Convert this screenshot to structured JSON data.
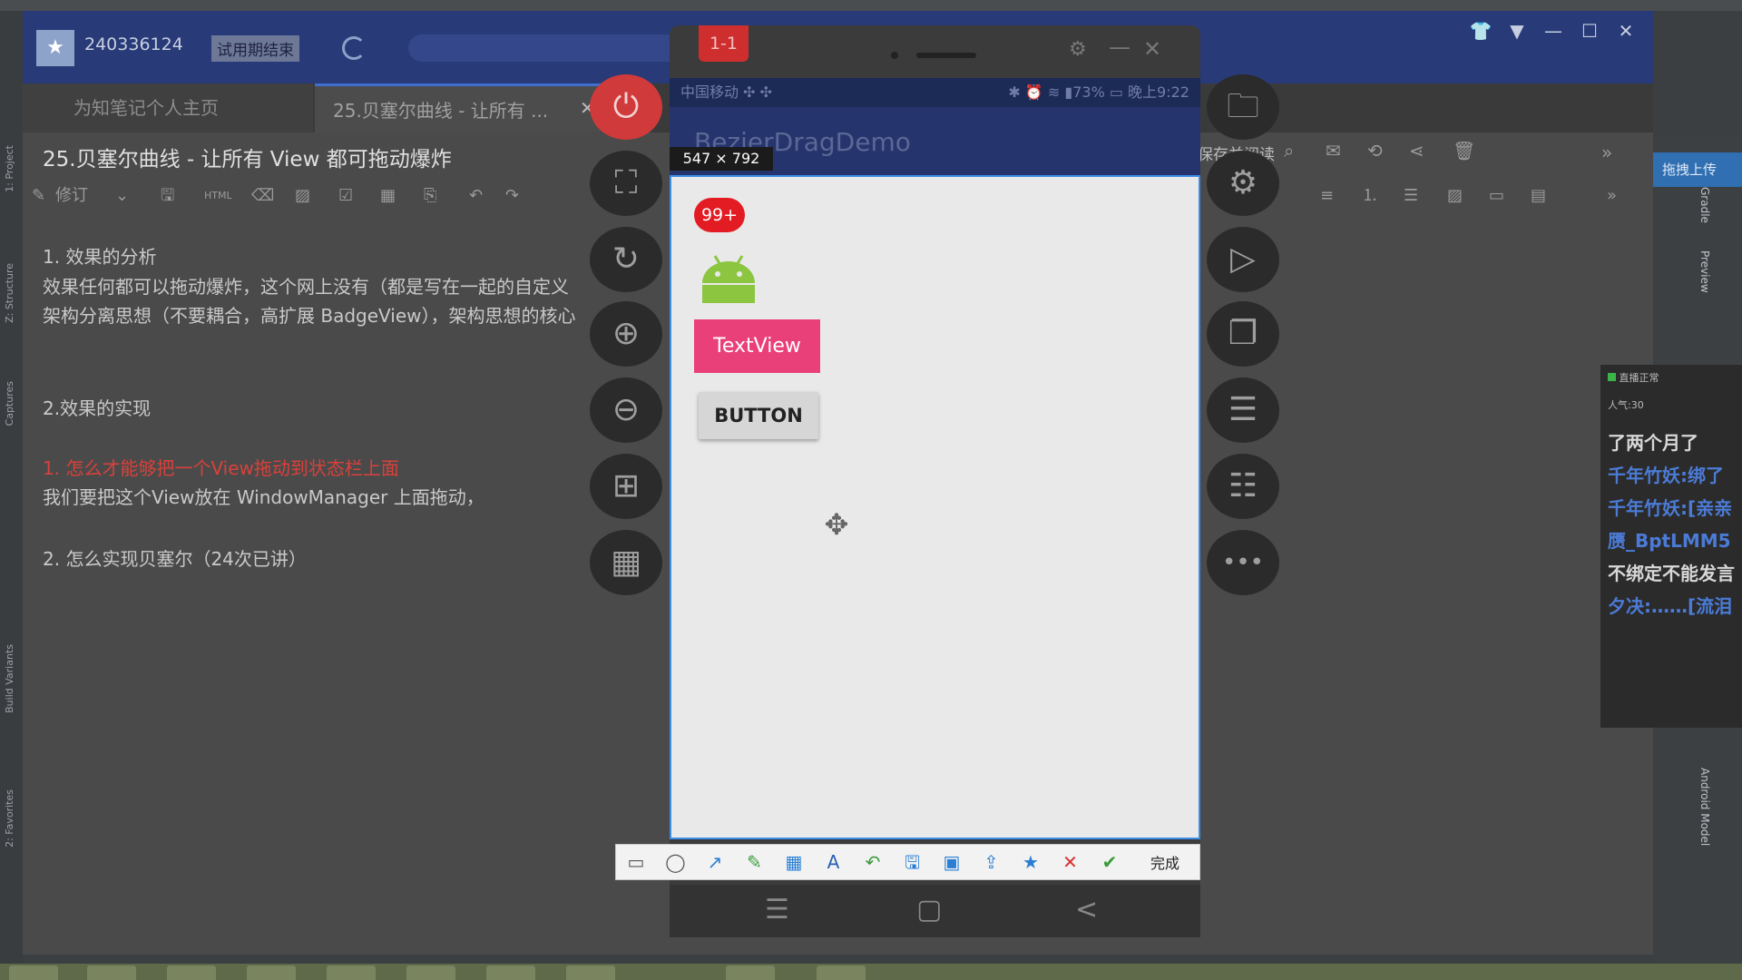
{
  "ide": {
    "left_tabs": [
      "1: Project",
      "Z: Structure",
      "Captures",
      "Build Variants",
      "2: Favorites"
    ],
    "right_tabs": [
      "Gradle",
      "Preview",
      "Android Model"
    ],
    "upload_label": "拖拽上传"
  },
  "note_app": {
    "account": "240336124",
    "trial_badge": "试用期结束",
    "window_controls": [
      "👕",
      "▼",
      "—",
      "☐",
      "✕"
    ],
    "tabs": [
      {
        "label": "为知笔记个人主页"
      },
      {
        "label": "25.贝塞尔曲线 - 让所有 ..."
      }
    ],
    "tab_close": "✕",
    "doc_title": "25.贝塞尔曲线 - 让所有 View 都可拖动爆炸",
    "toolbar": {
      "revise_label": "修订",
      "html_label": "HTML",
      "right_label": "保存并阅读"
    },
    "content": {
      "h1": "1. 效果的分析",
      "p1": "效果任何都可以拖动爆炸，这个网上没有（都是写在一起的自定义",
      "p2": "架构分离思想（不要耦合，高扩展 BadgeView），架构思想的核心",
      "h2": "2.效果的实现",
      "q1": "1. 怎么才能够把一个View拖动到状态栏上面",
      "p3": "我们要把这个View放在 WindowManager 上面拖动，",
      "q2": "2. 怎么实现贝塞尔（24次已讲）"
    }
  },
  "emulator": {
    "tag": "1-1",
    "status_left": "中国移动 ✣ ✣",
    "status_right": "✱ ⏰ ≋ ▮73% ▭ 晚上9:22",
    "app_title": "BezierDragDemo",
    "selection_size": "547 × 792",
    "badge": "99+",
    "textview": "TextView",
    "button": "BUTTON",
    "nav": [
      "☰",
      "▢",
      "<"
    ],
    "left_controls": [
      {
        "name": "power",
        "glyph": "⏻"
      },
      {
        "name": "fullscreen",
        "glyph": "⛶"
      },
      {
        "name": "rotate",
        "glyph": "↻"
      },
      {
        "name": "volume-up",
        "glyph": "⊕"
      },
      {
        "name": "volume-down",
        "glyph": "⊖"
      },
      {
        "name": "screenshot",
        "glyph": "⊞"
      },
      {
        "name": "record",
        "glyph": "▦"
      }
    ],
    "right_controls": [
      {
        "name": "folder",
        "glyph": "🗀"
      },
      {
        "name": "android",
        "glyph": "⚙"
      },
      {
        "name": "play",
        "glyph": "▷"
      },
      {
        "name": "copy",
        "glyph": "❐"
      },
      {
        "name": "list",
        "glyph": "☰"
      },
      {
        "name": "contacts",
        "glyph": "☷"
      },
      {
        "name": "more",
        "glyph": "•••"
      }
    ]
  },
  "snip_toolbar": {
    "tools": [
      {
        "name": "rect-tool",
        "glyph": "▭",
        "color": "#555555"
      },
      {
        "name": "ellipse-tool",
        "glyph": "◯",
        "color": "#555555"
      },
      {
        "name": "arrow-tool",
        "glyph": "↗",
        "color": "#2a7fd4"
      },
      {
        "name": "pen-tool",
        "glyph": "✎",
        "color": "#3a9b3a"
      },
      {
        "name": "mosaic-tool",
        "glyph": "▦",
        "color": "#2a7fd4"
      },
      {
        "name": "text-tool",
        "glyph": "A",
        "color": "#2a5fb4"
      },
      {
        "name": "undo-tool",
        "glyph": "↶",
        "color": "#3a9b3a"
      },
      {
        "name": "save-tool",
        "glyph": "🖫",
        "color": "#2a7fd4"
      },
      {
        "name": "copy-tool",
        "glyph": "▣",
        "color": "#2a7fd4"
      },
      {
        "name": "share-tool",
        "glyph": "⇪",
        "color": "#2a7fd4"
      },
      {
        "name": "pin-tool",
        "glyph": "★",
        "color": "#2a7fd4"
      },
      {
        "name": "cancel-tool",
        "glyph": "✕",
        "color": "#d83030"
      },
      {
        "name": "confirm-tool",
        "glyph": "✔",
        "color": "#3a9b3a"
      }
    ],
    "done_label": "完成"
  },
  "live_chat": {
    "header": "直播正常",
    "popularity": "人气:30",
    "lines": [
      {
        "text": "了两个月了",
        "color": "#d8d8d8"
      },
      {
        "text": "千年竹妖:绑了",
        "color": "#4b7bd6"
      },
      {
        "text": "千年竹妖:[亲亲",
        "color": "#4b7bd6"
      },
      {
        "text": "赝_BptLMM5",
        "color": "#4b7bd6"
      },
      {
        "text": "不绑定不能发言",
        "color": "#d8d8d8"
      },
      {
        "text": "夕决:……[流泪",
        "color": "#4b7bd6"
      }
    ]
  }
}
